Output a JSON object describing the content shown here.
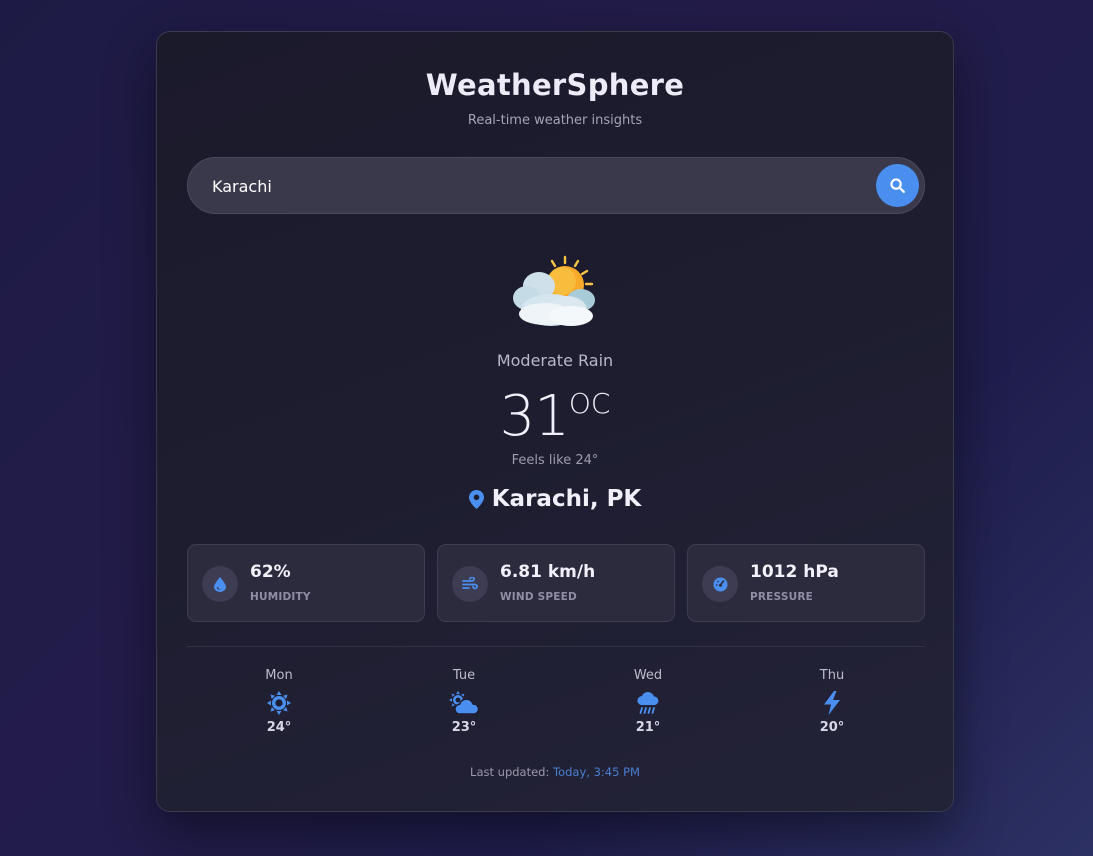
{
  "app": {
    "title": "WeatherSphere",
    "subtitle": "Real-time weather insights"
  },
  "search": {
    "value": "Karachi",
    "button_icon": "search-icon"
  },
  "current": {
    "icon": "sun-behind-cloud-icon",
    "condition": "Moderate Rain",
    "temperature": "31",
    "unit": "OC",
    "feels_like": "Feels like 24°",
    "location": "Karachi, PK",
    "location_icon": "map-pin-icon"
  },
  "stats": [
    {
      "icon": "droplet-icon",
      "value": "62%",
      "label": "HUMIDITY"
    },
    {
      "icon": "wind-icon",
      "value": "6.81 km/h",
      "label": "WIND SPEED"
    },
    {
      "icon": "gauge-icon",
      "value": "1012 hPa",
      "label": "PRESSURE"
    }
  ],
  "forecast": [
    {
      "day": "Mon",
      "icon": "sun-icon",
      "temp": "24°"
    },
    {
      "day": "Tue",
      "icon": "cloud-sun-icon",
      "temp": "23°"
    },
    {
      "day": "Wed",
      "icon": "cloud-rain-icon",
      "temp": "21°"
    },
    {
      "day": "Thu",
      "icon": "lightning-icon",
      "temp": "20°"
    }
  ],
  "footer": {
    "label": "Last updated:",
    "time": "Today, 3:45 PM"
  },
  "colors": {
    "accent": "#4a8ff0",
    "card_bg": "#1e1d30",
    "text_primary": "#f1f0fa"
  }
}
